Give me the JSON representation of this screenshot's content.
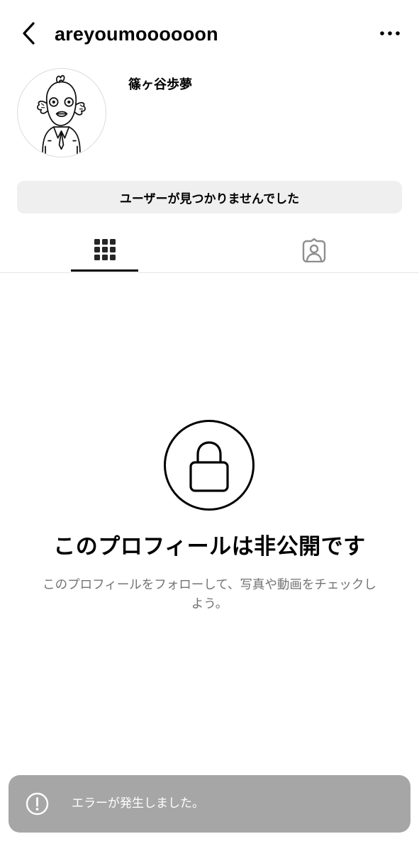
{
  "header": {
    "username": "areyoumoooooon",
    "back_icon": "chevron-left-icon",
    "more_icon": "more-horizontal-icon"
  },
  "profile": {
    "display_name": "篠ヶ谷歩夢",
    "avatar": "fish-man-illustration",
    "status_button_label": "ユーザーが見つかりませんでした"
  },
  "tabs": [
    {
      "name": "posts-grid",
      "icon": "grid-icon",
      "active": true
    },
    {
      "name": "tagged",
      "icon": "tagged-person-icon",
      "active": false
    }
  ],
  "private_notice": {
    "icon": "lock-icon",
    "title": "このプロフィールは非公開です",
    "description": "このプロフィールをフォローして、写真や動画をチェックしよう。"
  },
  "toast": {
    "icon": "exclamation-circle-icon",
    "message": "エラーが発生しました。"
  },
  "colors": {
    "background": "#ffffff",
    "button_bg": "#efefef",
    "secondary_text": "#737373",
    "inactive_icon": "#8e8e8e",
    "toast_bg": "#a6a6a6",
    "divider": "#e6e6e6"
  }
}
